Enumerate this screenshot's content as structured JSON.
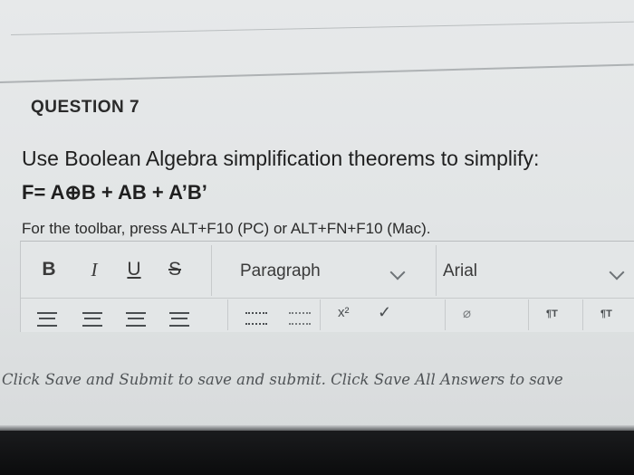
{
  "question": {
    "title": "QUESTION 7",
    "prompt": "Use Boolean Algebra simplification theorems to simplify:",
    "formula": "F= A⊕B  +  AB  + A’B’"
  },
  "editor": {
    "toolbar_hint": "For the toolbar, press ALT+F10 (PC) or ALT+FN+F10 (Mac).",
    "format_buttons": {
      "bold": "B",
      "italic": "I",
      "underline": "U",
      "strikethrough": "S"
    },
    "paragraph_select": "Paragraph",
    "font_select": "Arial",
    "row2": {
      "superscript": "x²",
      "check": "✓",
      "clear_format": "⌀",
      "ltr": "¶T",
      "rtl": "¶T"
    }
  },
  "footer": {
    "save_note": "Click Save and Submit to save and submit. Click Save All Answers to save"
  },
  "icons": {
    "align": "align-lines-icon",
    "list": "list-icon",
    "chevron": "chevron-down-icon"
  }
}
